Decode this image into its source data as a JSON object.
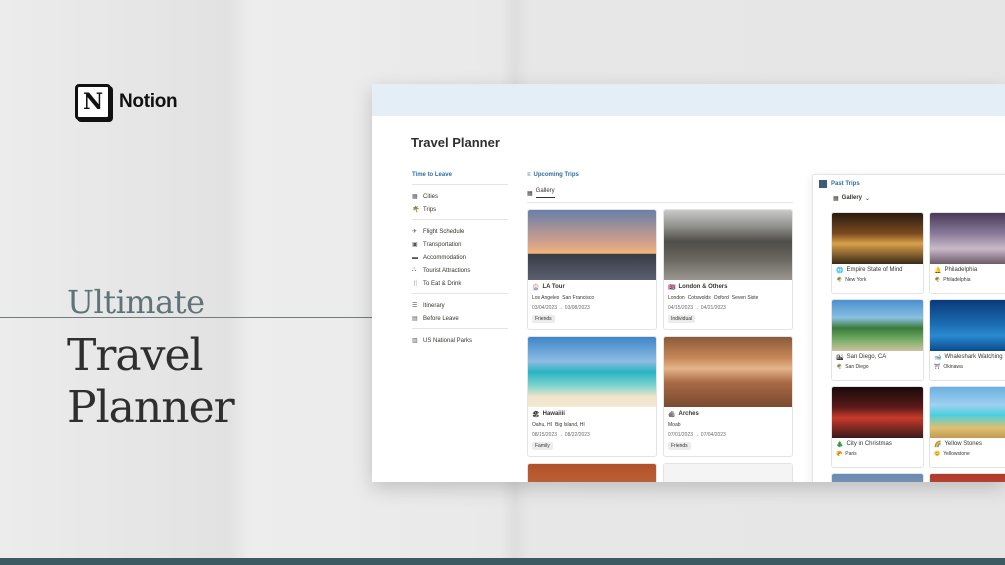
{
  "brand": {
    "logo_letter": "N",
    "name": "Notion"
  },
  "hero": {
    "subtitle": "Ultimate",
    "title_lines": [
      "Travel",
      "Planner"
    ]
  },
  "page": {
    "title": "Travel Planner"
  },
  "nav": {
    "heading": "Time to Leave",
    "groups": [
      [
        {
          "icon": "building-icon",
          "label": "Cities"
        },
        {
          "icon": "palm-icon",
          "label": "Trips"
        }
      ],
      [
        {
          "icon": "plane-icon",
          "label": "Flight Schedule"
        },
        {
          "icon": "train-icon",
          "label": "Transportation"
        },
        {
          "icon": "bed-icon",
          "label": "Accommodation"
        },
        {
          "icon": "attraction-icon",
          "label": "Tourist Attractions"
        },
        {
          "icon": "fork-icon",
          "label": "To Eat & Drink"
        }
      ],
      [
        {
          "icon": "list-icon",
          "label": "Itinerary"
        },
        {
          "icon": "suitcase-icon",
          "label": "Before Leave"
        }
      ],
      [
        {
          "icon": "map-icon",
          "label": "US National Parks"
        }
      ]
    ]
  },
  "upcoming": {
    "title": "Upcoming Trips",
    "view": "Gallery",
    "cards": [
      {
        "name": "LA Tour",
        "tags": [
          "Los Angeles",
          "San Francisco"
        ],
        "dates": "03/04/2023 → 03/08/2023",
        "group": "Friends"
      },
      {
        "name": "London & Others",
        "tags": [
          "London",
          "Cotswolds",
          "Oxford",
          "Seven Siste"
        ],
        "dates": "04/15/2023 → 04/21/2023",
        "group": "Individual"
      },
      {
        "name": "Hawaiiii",
        "tags": [
          "Oahu, HI",
          "Big Island, HI"
        ],
        "dates": "08/15/2023 → 08/22/2023",
        "group": "Family"
      },
      {
        "name": "Arches",
        "tags": [
          "Moab"
        ],
        "dates": "07/01/2023 → 07/04/2023",
        "group": "Friends"
      }
    ]
  },
  "past": {
    "title": "Past Trips",
    "view": "Gallery",
    "cards": [
      {
        "name": "Empire State of Mind",
        "location": "New York"
      },
      {
        "name": "Philadelphia",
        "location": "Philadelphia"
      },
      {
        "name": "San Diego, CA",
        "location": "San Diego"
      },
      {
        "name": "Whaleshark Watching",
        "location": "Okinawa"
      },
      {
        "name": "City in Christmas",
        "location": "Paris"
      },
      {
        "name": "Yellow Stones",
        "location": "Yellowstone"
      }
    ]
  },
  "colors": {
    "accent": "#2f6fa3",
    "bottom_bar": "#3b5a62",
    "hero_sub": "#5f7478"
  }
}
